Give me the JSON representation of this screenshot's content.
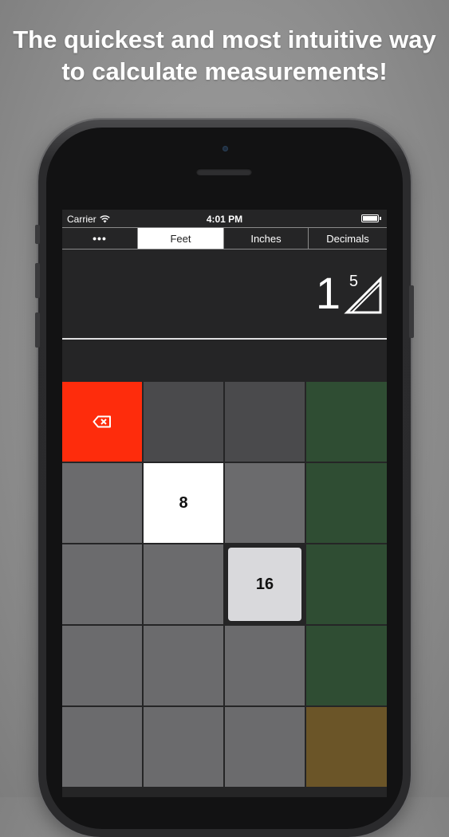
{
  "headline": {
    "line1": "The quickest and most intuitive way",
    "line2": "to calculate measurements!"
  },
  "status_bar": {
    "carrier": "Carrier",
    "wifi_icon": "wifi-icon",
    "time": "4:01 PM",
    "battery_icon": "battery-icon"
  },
  "tabs": [
    {
      "label": "•••",
      "active": false
    },
    {
      "label": "Feet",
      "active": true
    },
    {
      "label": "Inches",
      "active": false
    },
    {
      "label": "Decimals",
      "active": false
    }
  ],
  "display": {
    "whole": "1",
    "numerator": "5",
    "fraction_icon": "fraction-triangle-icon"
  },
  "keypad": {
    "backspace_icon": "backspace-icon",
    "key_8": "8",
    "key_16": "16"
  },
  "colors": {
    "backspace": "#fe2c0c",
    "green_column": "#2f4d33",
    "brown_key": "#6b5528",
    "gray_key": "#6b6b6d",
    "dark_key": "#4a4a4c"
  }
}
